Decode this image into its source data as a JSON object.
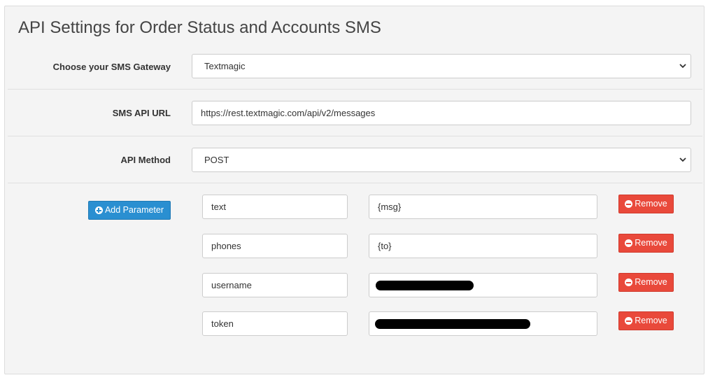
{
  "panel": {
    "title": "API Settings for Order Status and Accounts SMS"
  },
  "gateway": {
    "label": "Choose your SMS Gateway",
    "selected": "Textmagic"
  },
  "api_url": {
    "label": "SMS API URL",
    "value": "https://rest.textmagic.com/api/v2/messages"
  },
  "api_method": {
    "label": "API Method",
    "selected": "POST"
  },
  "parameters": {
    "add_label": "Add Parameter",
    "remove_label": "Remove",
    "rows": [
      {
        "key": "text",
        "value": "{msg}",
        "value_redacted": false
      },
      {
        "key": "phones",
        "value": "{to}",
        "value_redacted": false
      },
      {
        "key": "username",
        "value": "",
        "value_redacted": true
      },
      {
        "key": "token",
        "value": "",
        "value_redacted": true
      }
    ]
  },
  "colors": {
    "add_button": "#2a8fd1",
    "remove_button": "#e9493b",
    "panel_background": "#f4f4f4"
  },
  "icons": {
    "add": "plus-circle-icon",
    "remove": "minus-circle-icon",
    "select_arrow": "chevron-down-icon"
  }
}
